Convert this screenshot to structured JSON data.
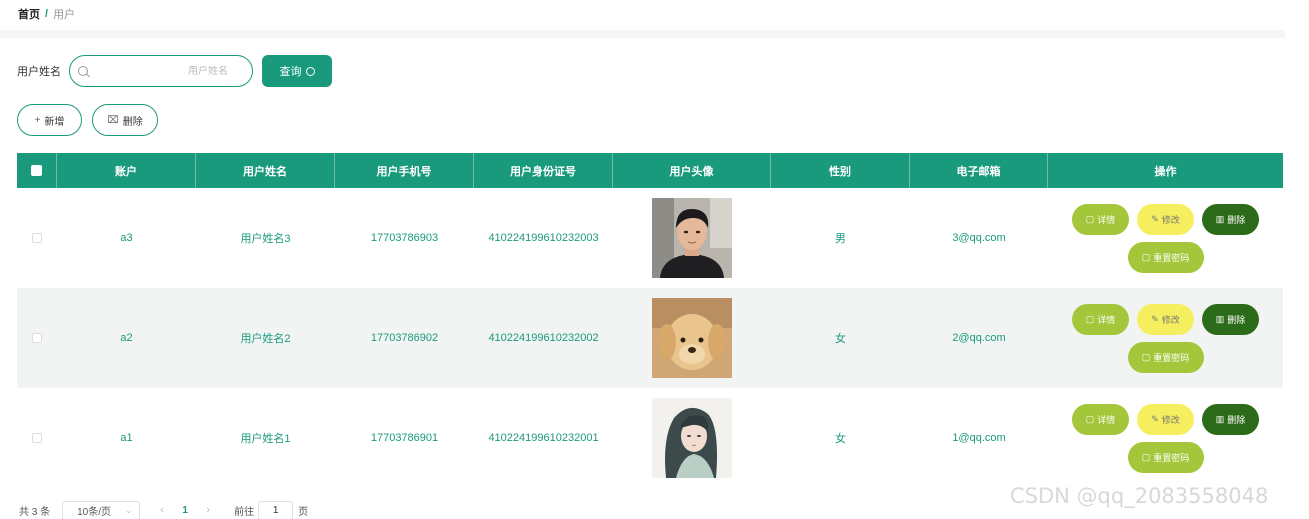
{
  "breadcrumb": {
    "home": "首页",
    "separator": "/",
    "current": "用户"
  },
  "search": {
    "label": "用户姓名",
    "placeholder": "用户姓名",
    "button_label": "查询"
  },
  "actions": {
    "add_label": "新增",
    "delete_label": "删除"
  },
  "table": {
    "columns": [
      "账户",
      "用户姓名",
      "用户手机号",
      "用户身份证号",
      "用户头像",
      "性别",
      "电子邮箱",
      "操作"
    ],
    "rows": [
      {
        "account": "a3",
        "name": "用户姓名3",
        "phone": "17703786903",
        "id_number": "410224199610232003",
        "avatar": "avatar-young-man",
        "gender": "男",
        "email": "3@qq.com"
      },
      {
        "account": "a2",
        "name": "用户姓名2",
        "phone": "17703786902",
        "id_number": "410224199610232002",
        "avatar": "avatar-puppy",
        "gender": "女",
        "email": "2@qq.com"
      },
      {
        "account": "a1",
        "name": "用户姓名1",
        "phone": "17703786901",
        "id_number": "410224199610232001",
        "avatar": "avatar-illustrated-girl",
        "gender": "女",
        "email": "1@qq.com"
      }
    ],
    "row_actions": {
      "detail": "详情",
      "edit": "修改",
      "delete": "删除",
      "reset_password": "重置密码"
    }
  },
  "pagination": {
    "total": "共 3 条",
    "page_size": "10条/页",
    "current_page": "1",
    "goto_label": "前往",
    "goto_value": "1",
    "page_unit": "页"
  },
  "watermark": "CSDN @qq_2083558048",
  "colors": {
    "primary": "#1a9a7d",
    "detail": "#a4c63a",
    "edit": "#f5ef5f",
    "delete": "#2c6b19"
  }
}
